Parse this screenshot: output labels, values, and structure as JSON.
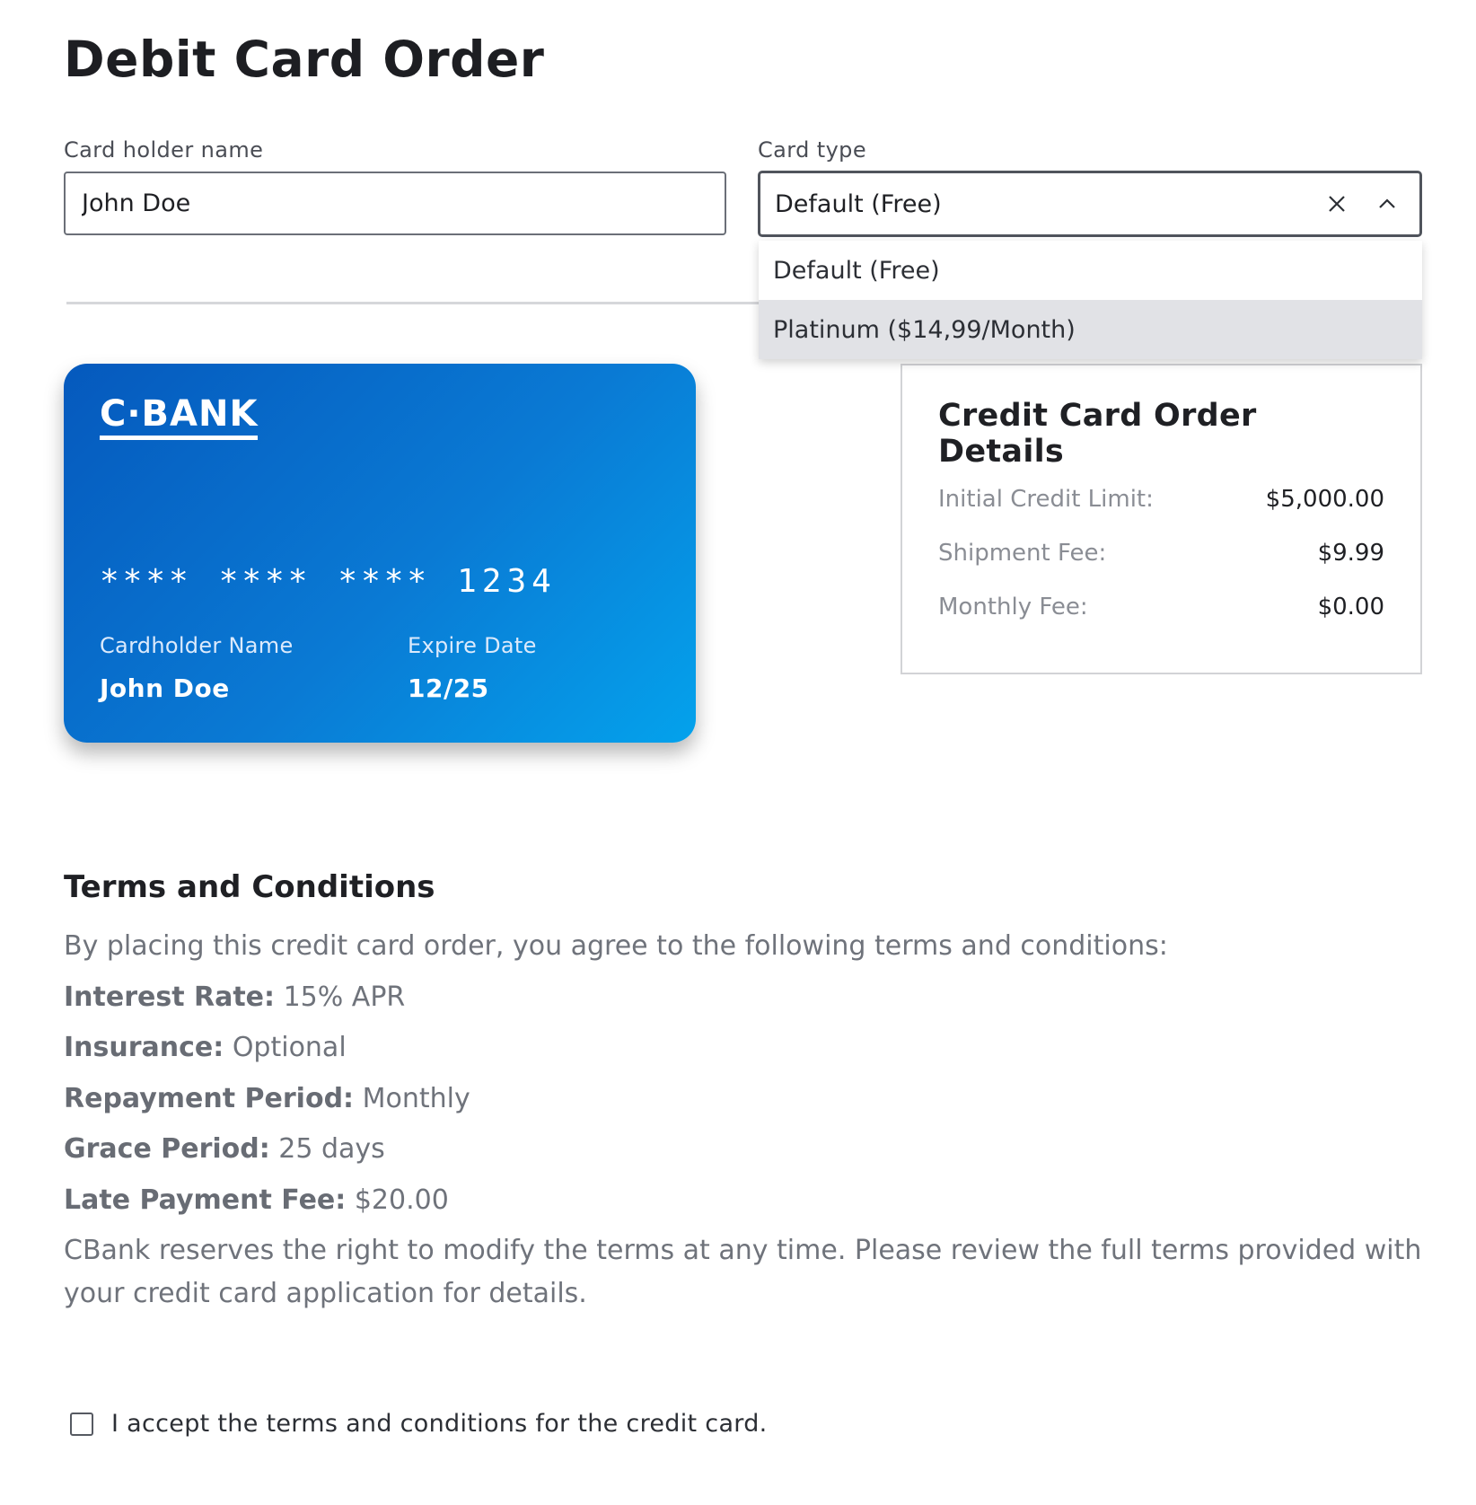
{
  "page": {
    "title": "Debit Card Order"
  },
  "form": {
    "name_label": "Card holder name",
    "name_value": "John Doe",
    "type_label": "Card type",
    "type_value": "Default (Free)",
    "type_options": [
      "Default (Free)",
      "Platinum ($14,99/Month)"
    ],
    "highlighted_option": "Platinum ($14,99/Month)",
    "clear_icon": "close-icon",
    "toggle_icon": "chevron-up-icon"
  },
  "card": {
    "bank_name": "C·BANK",
    "number_groups": [
      "****",
      "****",
      "****",
      "1234"
    ],
    "holder_label": "Cardholder Name",
    "holder_value": "John Doe",
    "expire_label": "Expire Date",
    "expire_value": "12/25",
    "gradient_start": "#0559bd",
    "gradient_end": "#04a2ec"
  },
  "details": {
    "title": "Credit Card Order Details",
    "rows": [
      {
        "label": "Initial Credit Limit:",
        "value": "$5,000.00"
      },
      {
        "label": "Shipment Fee:",
        "value": "$9.99"
      },
      {
        "label": "Monthly Fee:",
        "value": "$0.00"
      }
    ]
  },
  "terms": {
    "title": "Terms and Conditions",
    "intro": "By placing this credit card order, you agree to the following terms and conditions:",
    "items": [
      {
        "label": "Interest Rate:",
        "value": "15% APR"
      },
      {
        "label": "Insurance:",
        "value": "Optional"
      },
      {
        "label": "Repayment Period:",
        "value": "Monthly"
      },
      {
        "label": "Grace Period:",
        "value": "25 days"
      },
      {
        "label": "Late Payment Fee:",
        "value": "$20.00"
      }
    ],
    "footer": "CBank reserves the right to modify the terms at any time. Please review the full terms provided with your credit card application for details."
  },
  "accept": {
    "label": "I accept the terms and conditions for the credit card.",
    "checked": false
  }
}
